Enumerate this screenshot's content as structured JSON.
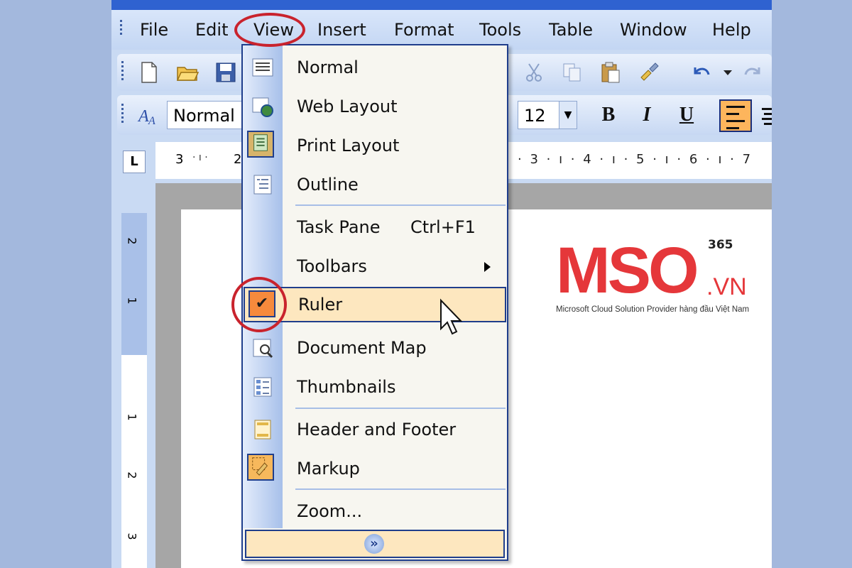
{
  "menubar": {
    "items": [
      "File",
      "Edit",
      "View",
      "Insert",
      "Format",
      "Tools",
      "Table",
      "Window",
      "Help"
    ],
    "active": "View"
  },
  "toolbar": {
    "style_value": "Normal",
    "font_size_value": "12",
    "bold_label": "B",
    "italic_label": "I",
    "underline_label": "U"
  },
  "ruler": {
    "corner_label": "L",
    "top_left_labels": [
      "3",
      "2"
    ],
    "top_right_labels": [
      "3",
      "4",
      "5",
      "6",
      "7"
    ],
    "left_labels": [
      "2",
      "1",
      "1",
      "2",
      "3"
    ]
  },
  "view_menu": {
    "items": [
      {
        "label": "Normal",
        "icon": "normal-view-icon"
      },
      {
        "label": "Web Layout",
        "icon": "web-layout-icon"
      },
      {
        "label": "Print Layout",
        "icon": "print-layout-icon",
        "checked": true
      },
      {
        "label": "Outline",
        "icon": "outline-icon"
      },
      {
        "label": "Task Pane",
        "shortcut": "Ctrl+F1"
      },
      {
        "label": "Toolbars",
        "submenu": true
      },
      {
        "label": "Ruler",
        "checked": true,
        "highlighted": true
      },
      {
        "label": "Document Map",
        "icon": "document-map-icon"
      },
      {
        "label": "Thumbnails",
        "icon": "thumbnails-icon"
      },
      {
        "label": "Header and Footer",
        "icon": "header-footer-icon"
      },
      {
        "label": "Markup",
        "icon": "markup-icon",
        "checked": true
      },
      {
        "label": "Zoom..."
      }
    ],
    "expand_icon": "double-chevron-down-icon"
  },
  "logo": {
    "main": "MSO",
    "suffix": ".VN",
    "superscript": "365",
    "tagline": "Microsoft Cloud Solution Provider hàng đầu Việt Nam"
  },
  "colors": {
    "menu_highlight": "#fde7bf",
    "checked_box": "#f68a3c",
    "annotation_ring": "#c9232d",
    "logo_red": "#e5373a",
    "menu_border": "#1f3e8c"
  }
}
